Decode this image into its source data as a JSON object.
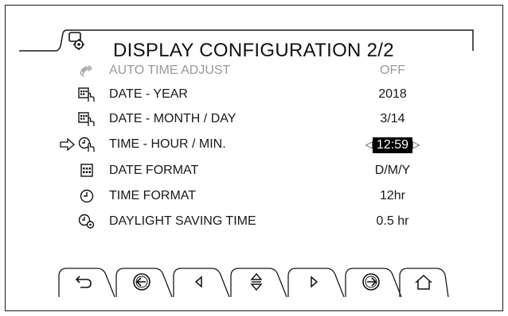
{
  "header": {
    "title": "DISPLAY CONFIGURATION  2/2",
    "icon": "display-settings-icon"
  },
  "rows": [
    {
      "label": "AUTO TIME ADJUST",
      "value": "OFF",
      "icon": "satellite-icon",
      "state": "disabled"
    },
    {
      "label": "DATE - YEAR",
      "value": "2018",
      "icon": "calendar-touch-icon",
      "state": "normal"
    },
    {
      "label": "DATE - MONTH / DAY",
      "value": "3/14",
      "icon": "calendar-touch-icon",
      "state": "normal"
    },
    {
      "label": "TIME - HOUR / MIN.",
      "value": "12:59",
      "icon": "clock-touch-icon",
      "state": "selected"
    },
    {
      "label": "DATE FORMAT",
      "value": "D/M/Y",
      "icon": "calendar-icon",
      "state": "normal"
    },
    {
      "label": "TIME FORMAT",
      "value": "12hr",
      "icon": "clock-icon",
      "state": "normal"
    },
    {
      "label": "DAYLIGHT SAVING TIME",
      "value": "0.5 hr",
      "icon": "clock-gear-icon",
      "state": "normal"
    }
  ],
  "toolbar": [
    {
      "name": "back-button",
      "icon": "return-arrow-icon"
    },
    {
      "name": "previous-page-button",
      "icon": "circle-arrow-left-icon"
    },
    {
      "name": "left-button",
      "icon": "triangle-left-icon"
    },
    {
      "name": "up-down-button",
      "icon": "up-down-arrows-icon"
    },
    {
      "name": "right-button",
      "icon": "triangle-right-icon"
    },
    {
      "name": "next-page-button",
      "icon": "circle-arrow-right-icon"
    },
    {
      "name": "home-button",
      "icon": "home-icon"
    }
  ],
  "colors": {
    "text": "#1a1a1a",
    "disabled_text": "#9a9a9a",
    "selection_bg": "#000000",
    "selection_fg": "#ffffff"
  }
}
